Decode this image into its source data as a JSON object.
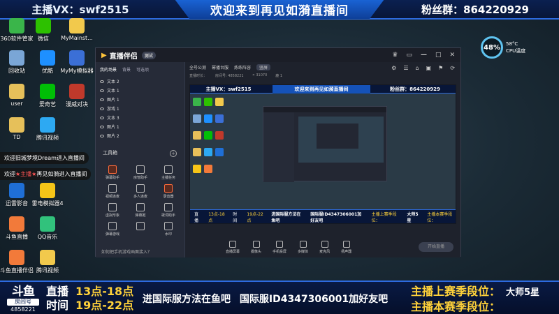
{
  "top": {
    "left": "主播VX：swf2515",
    "center": "欢迎来到再见如漪直播间",
    "right": "粉丝群：864220929"
  },
  "desktop_icons": [
    {
      "label": "360软件管家",
      "color": "#3ab54a"
    },
    {
      "label": "微信",
      "color": "#2dc100"
    },
    {
      "label": "MyMainst...",
      "color": "#f2c94c"
    },
    {
      "label": "回收站",
      "color": "#7aa6d6"
    },
    {
      "label": "优酷",
      "color": "#1e90ff"
    },
    {
      "label": "MyMy模拟器",
      "color": "#3b6fd6"
    },
    {
      "label": "user",
      "color": "#e6c05a"
    },
    {
      "label": "爱奇艺",
      "color": "#00be06"
    },
    {
      "label": "漫威对决",
      "color": "#c0392b"
    },
    {
      "label": "TD",
      "color": "#e6c05a"
    },
    {
      "label": "腾讯视频",
      "color": "#2da9f2"
    },
    {
      "label": "迅雷影音",
      "color": "#1f6fd6"
    },
    {
      "label": "雷电模拟器4",
      "color": "#f5c518"
    },
    {
      "label": "斗鱼直播",
      "color": "#f27a3a"
    },
    {
      "label": "QQ音乐",
      "color": "#31c27c"
    },
    {
      "label": "斗鱼直播伴侣",
      "color": "#f27a3a"
    },
    {
      "label": "腾讯视频",
      "color": "#f2c94c"
    }
  ],
  "danmaku": [
    {
      "text": "欢迎旧城梦境Dream进入直播间",
      "hl": ""
    },
    {
      "pre": "欢迎",
      "hl": "★主播★",
      "post": "再见如漪进入直播间"
    }
  ],
  "cpu": {
    "percent": "48%",
    "temp": "58°C",
    "label": "CPU温度"
  },
  "app": {
    "title": "直播伴侣",
    "badge": "测试",
    "ctrls": [
      "♛",
      "▭",
      "—",
      "□",
      "✕"
    ],
    "tabs": [
      "我的场景",
      "背景",
      "可选项"
    ],
    "layers": [
      "文本 2",
      "文本 1",
      "图片 1",
      "游戏 1",
      "文本 3",
      "图片 1",
      "图片 2"
    ],
    "tools_title": "工具箱",
    "tools": [
      "弹幕助手",
      "房管助手",
      "主播任务",
      "视频连麦",
      "多人连麦",
      "录音器",
      "虚拟形象",
      "弹幕姬",
      "歌词助手",
      "弹幕游戏",
      "",
      "水印"
    ],
    "footer": "如何把手机游戏画面接入？",
    "header": [
      "全号公测",
      "幂播台服",
      "炼练阵容",
      "导出"
    ],
    "mode": "竖屏",
    "sub": [
      "直播时长：",
      "房间号: 4858221",
      "⚭ 31070",
      "鹿 1"
    ],
    "right_icons": [
      "⚙",
      "☰",
      "⌂",
      "▣",
      "⚑",
      "⟳"
    ],
    "bottom_tools": [
      "直播屏幕",
      "摄像头",
      "手机投屏",
      "多媒体",
      "麦克风",
      "扬声器"
    ],
    "live_btn": "开始直播"
  },
  "preview": {
    "top_left": "主播VX：swf2515",
    "top_center": "欢迎来到再见如漪直播间",
    "top_right": "粉丝群：864220929",
    "b1": "直播",
    "b2": "13点-18点",
    "b3": "时间",
    "b4": "19点-22点",
    "b5": "进国际服方法在鱼吧",
    "b6": "国际服ID4347306001加好友吧",
    "b7": "主播上赛季段位：",
    "b8": "大师5星",
    "b9": "主播本赛季段位："
  },
  "bottom": {
    "logo": "斗鱼",
    "room": "房间号",
    "room_no": "4858221",
    "live": "直播",
    "live_hours": "13点-18点",
    "time": "时间",
    "time_hours": "19点-22点",
    "announce": "进国际服方法在鱼吧 国际服ID4347306001加好友吧",
    "rank_last": "主播上赛季段位：",
    "rank_last_val": "大师5星",
    "rank_now": "主播本赛季段位："
  }
}
